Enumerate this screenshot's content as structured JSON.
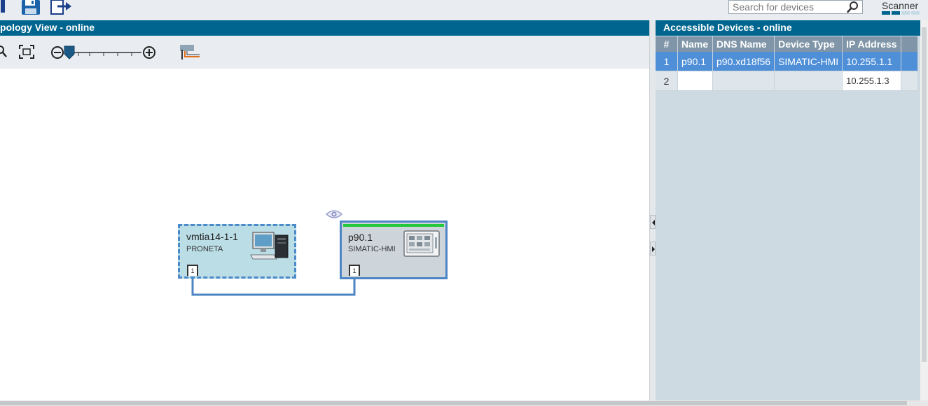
{
  "toolbar": {
    "icons": [
      "network-icon",
      "save-icon",
      "export-icon"
    ]
  },
  "search": {
    "placeholder": "Search for devices",
    "icon": "magnifier-icon"
  },
  "scanner": {
    "label": "Scanner",
    "progress_steps_total": 4,
    "progress_steps_done": 2
  },
  "colors": {
    "header": "#01668f",
    "selected_row": "#4f8fd8",
    "link_line": "#4e85c4",
    "status_ok": "#22c73a"
  },
  "topology": {
    "title": "pology View - online",
    "toolbar": {
      "zoom_icon": "zoom-icon",
      "fit_icon": "fit-to-view-icon",
      "zoom_out_icon": "zoom-out-icon",
      "zoom_in_icon": "zoom-in-icon",
      "zoom_level": 0.12,
      "layout_icon": "layout-icon"
    },
    "devices": [
      {
        "name": "vmtia14-1-1",
        "type": "PRONETA",
        "port": "1",
        "icon": "pc-icon"
      },
      {
        "name": "p90.1",
        "type": "SIMATIC-HMI",
        "port": "1",
        "icon": "hmi-panel-icon"
      }
    ],
    "eye_icon": "eye-icon"
  },
  "accessible": {
    "title": "Accessible Devices - online",
    "columns": [
      "#",
      "Name",
      "DNS Name",
      "Device Type",
      "IP Address"
    ],
    "rows": [
      {
        "num": "1",
        "name": "p90.1",
        "dns": "p90.xd18f56",
        "type": "SIMATIC-HMI",
        "ip": "10.255.1.1"
      },
      {
        "num": "2",
        "name": "",
        "dns": "",
        "type": "",
        "ip": "10.255.1.3"
      }
    ]
  }
}
